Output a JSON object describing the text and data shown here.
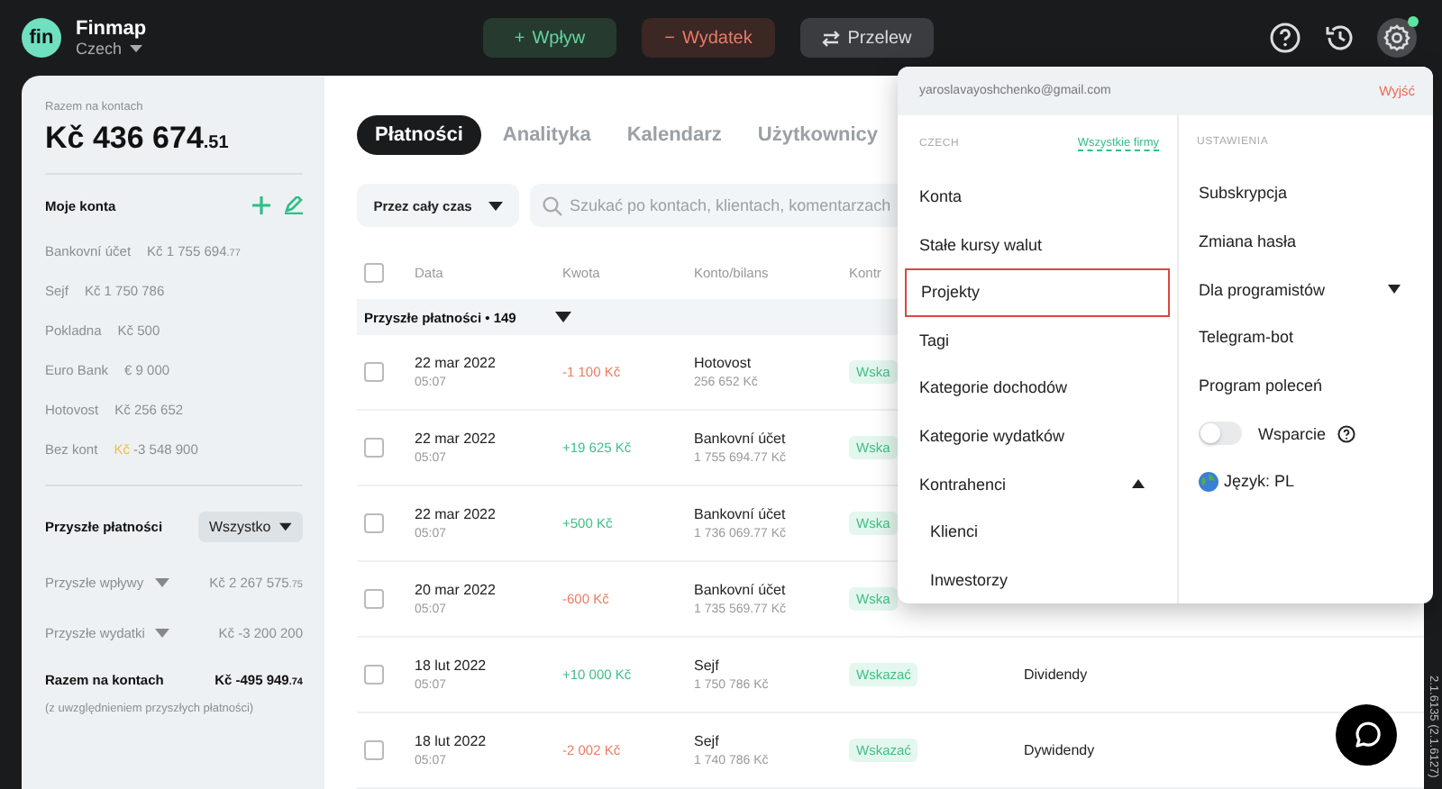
{
  "topbar": {
    "logo": "fin",
    "app_name": "Finmap",
    "company": "Czech",
    "actions": [
      {
        "kind": "income",
        "symbol": "+",
        "label": "Wpływ"
      },
      {
        "kind": "expense",
        "symbol": "−",
        "label": "Wydatek"
      },
      {
        "kind": "transfer",
        "label": "Przelew"
      }
    ],
    "icons": [
      {
        "kind": "help"
      },
      {
        "kind": "history"
      },
      {
        "kind": "settings",
        "dot": true
      }
    ]
  },
  "sidebar": {
    "total_label": "Razem na kontach",
    "total": "Kč 436 674",
    "total_decimals": ".51",
    "accounts_title": "Moje konta",
    "accounts": [
      {
        "name": "Bankovní účet",
        "currency": "Kč",
        "value": "1 755 694",
        "decimals": ".77",
        "warning": false
      },
      {
        "name": "Sejf",
        "currency": "Kč",
        "value": "1 750 786",
        "warning": false
      },
      {
        "name": "Pokladna",
        "currency": "Kč",
        "value": "500",
        "warning": false
      },
      {
        "name": "Euro Bank",
        "currency": "€",
        "value": "9 000",
        "warning": false
      },
      {
        "name": "Hotovost",
        "currency": "Kč",
        "value": "256 652",
        "warning": false
      },
      {
        "name": "Bez kont",
        "currency": "Kč",
        "value": "-3 548 900",
        "warning": true
      }
    ],
    "future_title": "Przyszłe płatności",
    "future_filter": "Wszystko",
    "future": [
      {
        "label": "Przyszłe wpływy",
        "value": "Kč 2 267 575",
        "decimals": ".75"
      },
      {
        "label": "Przyszłe wydatki",
        "value": "Kč -3 200 200"
      }
    ],
    "future_total_label": "Razem na kontach",
    "future_total": "Kč -495 949",
    "future_total_decimals": ".74",
    "future_note": "(z uwzględnieniem przyszłych płatności)"
  },
  "main": {
    "tabs": [
      {
        "label": "Płatności",
        "selected": true
      },
      {
        "label": "Analityka",
        "selected": false
      },
      {
        "label": "Kalendarz",
        "selected": false
      },
      {
        "label": "Użytkownicy",
        "selected": false
      }
    ],
    "period": "Przez cały czas",
    "search": {
      "placeholder": "Szukać po kontach, klientach, komentarzach"
    },
    "table": {
      "select_all": false,
      "columns": [
        "Data",
        "Kwota",
        "Konto/bilans",
        "Kontr"
      ],
      "group": {
        "label": "Przyszłe płatności • 149",
        "expanded": true
      },
      "rows": [
        {
          "checked": false,
          "date": "22 mar 2022",
          "time": "05:07",
          "kind": "expense",
          "amount": "-1 100 Kč",
          "account": "Hotovost",
          "balance": "256 652 Kč",
          "counterparty": "Wska"
        },
        {
          "checked": false,
          "date": "22 mar 2022",
          "time": "05:07",
          "kind": "income",
          "amount": "+19 625 Kč",
          "account": "Bankovní účet",
          "balance": "1 755 694.77 Kč",
          "counterparty": "Wska"
        },
        {
          "checked": false,
          "date": "22 mar 2022",
          "time": "05:07",
          "kind": "income",
          "amount": "+500 Kč",
          "account": "Bankovní účet",
          "balance": "1 736 069.77 Kč",
          "counterparty": "Wska"
        },
        {
          "checked": false,
          "date": "20 mar 2022",
          "time": "05:07",
          "kind": "expense",
          "amount": "-600 Kč",
          "account": "Bankovní účet",
          "balance": "1 735 569.77 Kč",
          "counterparty": "Wska"
        },
        {
          "checked": false,
          "date": "18 lut 2022",
          "time": "05:07",
          "kind": "income",
          "amount": "+10 000 Kč",
          "account": "Sejf",
          "balance": "1 750 786 Kč",
          "counterparty": "Wskazać",
          "category": "Dividendy"
        },
        {
          "checked": false,
          "date": "18 lut 2022",
          "time": "05:07",
          "kind": "expense",
          "amount": "-2 002 Kč",
          "account": "Sejf",
          "balance": "1 740 786 Kč",
          "counterparty": "Wskazać",
          "category": "Dywidendy"
        }
      ]
    }
  },
  "menu": {
    "email": "yaroslavayoshchenko@gmail.com",
    "logout": "Wyjść",
    "company_title": "CZECH",
    "all_companies": "Wszystkie firmy",
    "items": [
      {
        "label": "Konta",
        "selected": false
      },
      {
        "label": "Stałe kursy walut",
        "selected": false
      },
      {
        "label": "Projekty",
        "selected": true
      },
      {
        "label": "Tagi",
        "selected": false
      },
      {
        "label": "Kategorie dochodów",
        "selected": false
      },
      {
        "label": "Kategorie wydatków",
        "selected": false
      },
      {
        "label": "Kontrahenci",
        "selected": false,
        "expanded": true,
        "children": [
          {
            "label": "Klienci",
            "selected": false
          },
          {
            "label": "Inwestorzy",
            "selected": false
          }
        ]
      }
    ],
    "settings_title": "USTAWIENIA",
    "settings": [
      {
        "kind": "link",
        "label": "Subskrypcja"
      },
      {
        "kind": "link",
        "label": "Zmiana hasła"
      },
      {
        "kind": "expandable",
        "label": "Dla programistów",
        "expanded": false
      },
      {
        "kind": "link",
        "label": "Telegram-bot"
      },
      {
        "kind": "link",
        "label": "Program poleceń"
      },
      {
        "kind": "toggle",
        "label": "Wsparcie",
        "on": false
      },
      {
        "kind": "language",
        "label": "Język: PL"
      }
    ]
  },
  "version": "2.1.6135 (2.1.6127)"
}
